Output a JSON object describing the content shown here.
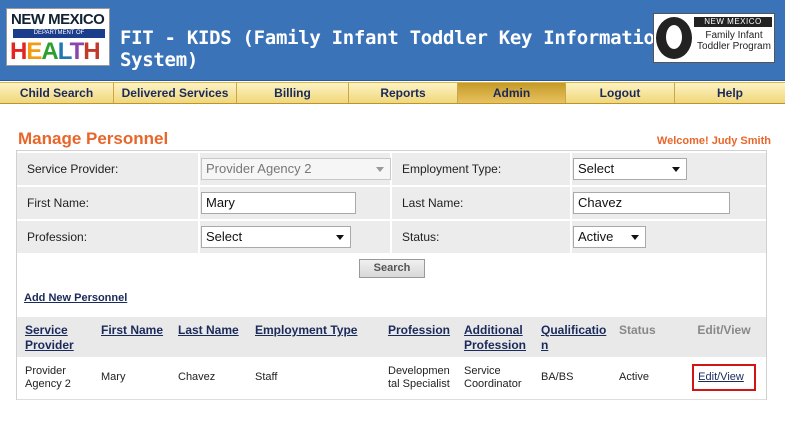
{
  "header": {
    "logo_left": {
      "line1": "NEW MEXICO",
      "line2": "DEPARTMENT OF",
      "line3": "HEALTH"
    },
    "app_title": "FIT - KIDS (Family Infant Toddler Key Information Data System)",
    "logo_right": {
      "line1": "NEW MEXICO",
      "line2": "Family Infant",
      "line3": "Toddler Program"
    }
  },
  "nav": {
    "items": [
      {
        "label": "Child Search"
      },
      {
        "label": "Delivered Services"
      },
      {
        "label": "Billing"
      },
      {
        "label": "Reports"
      },
      {
        "label": "Admin"
      },
      {
        "label": "Logout"
      },
      {
        "label": "Help"
      }
    ],
    "active": "Admin"
  },
  "page": {
    "title": "Manage Personnel",
    "welcome": "Welcome! Judy Smith"
  },
  "form": {
    "service_provider_label": "Service Provider:",
    "service_provider_value": "Provider Agency 2",
    "employment_type_label": "Employment Type:",
    "employment_type_value": "Select",
    "first_name_label": "First Name:",
    "first_name_value": "Mary",
    "last_name_label": "Last Name:",
    "last_name_value": "Chavez",
    "profession_label": "Profession:",
    "profession_value": "Select",
    "status_label": "Status:",
    "status_value": "Active",
    "search_label": "Search"
  },
  "add_new_label": "Add New Personnel",
  "table": {
    "headers": [
      "Service Provider",
      "First Name",
      "Last Name",
      "Employment Type",
      "Profession",
      "Additional Profession",
      "Qualification",
      "Status",
      "Edit/View"
    ],
    "rows": [
      {
        "service_provider": "Provider Agency 2",
        "first_name": "Mary",
        "last_name": "Chavez",
        "employment_type": "Staff",
        "profession": "Developmental Specialist",
        "additional_profession": "Service Coordinator",
        "qualification": "BA/BS",
        "status": "Active",
        "edit": "Edit/View"
      }
    ]
  },
  "colors": {
    "header_bg": "#3b73b9",
    "accent": "#e8662a",
    "link": "#1a2a5a",
    "highlight": "#d01515"
  }
}
